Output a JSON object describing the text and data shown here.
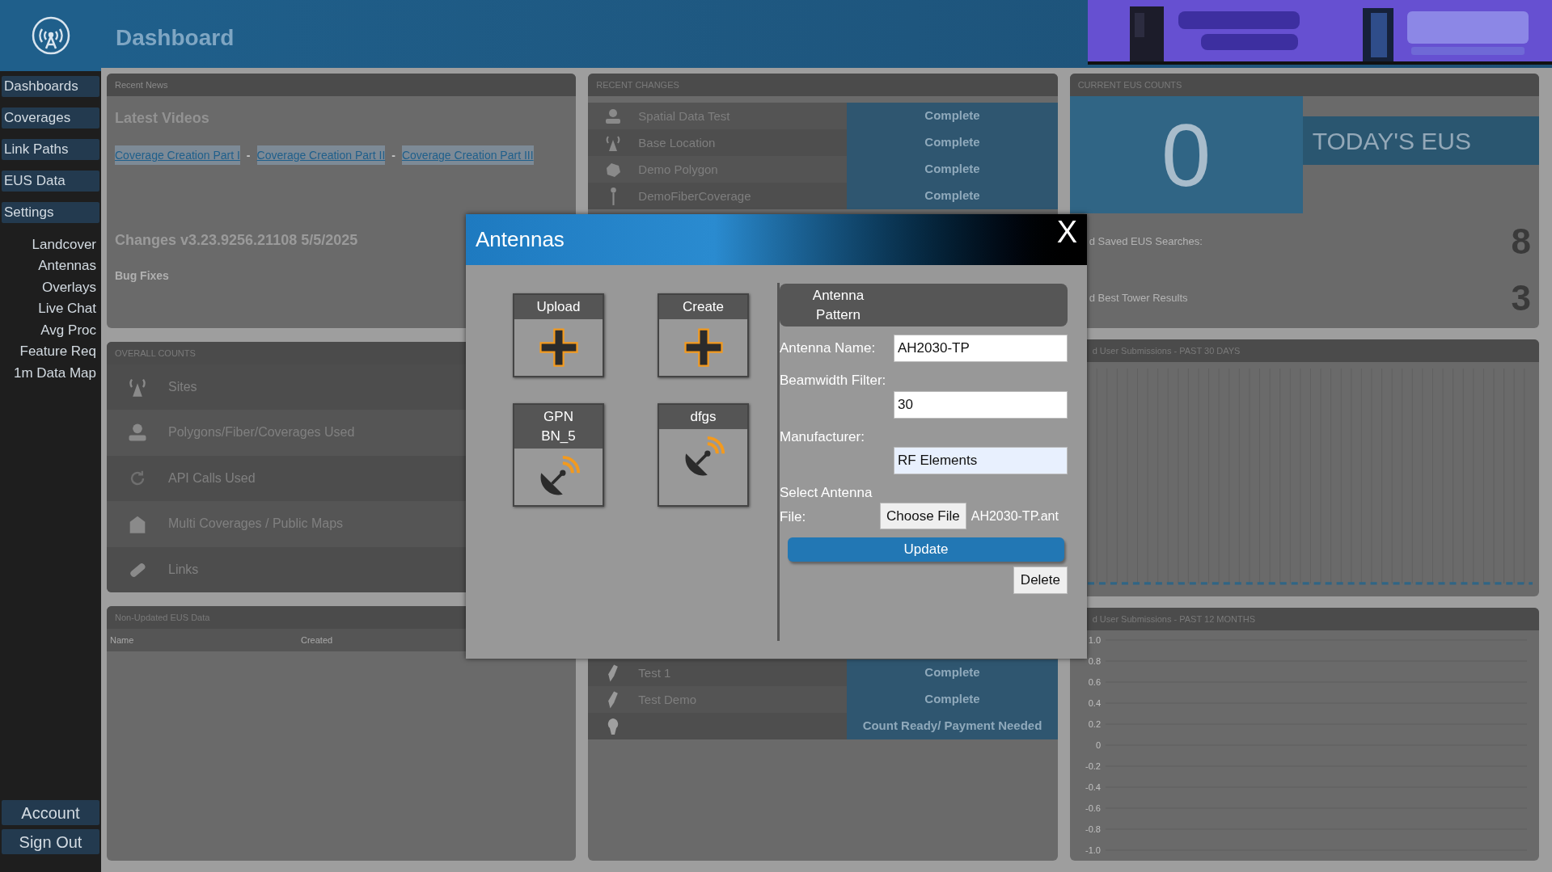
{
  "sidebar": {
    "nav": [
      {
        "label": "Dashboards",
        "kind": "main"
      },
      {
        "label": "Coverages",
        "kind": "main"
      },
      {
        "label": "Link Paths",
        "kind": "main"
      },
      {
        "label": "EUS Data",
        "kind": "main"
      },
      {
        "label": "Settings",
        "kind": "main"
      },
      {
        "label": "Landcover",
        "kind": "sub"
      },
      {
        "label": "Antennas",
        "kind": "sub"
      },
      {
        "label": "Overlays",
        "kind": "sub"
      },
      {
        "label": "Live Chat",
        "kind": "sub"
      },
      {
        "label": "Avg Proc",
        "kind": "sub"
      },
      {
        "label": "Feature Req",
        "kind": "sub"
      },
      {
        "label": "1m Data Map",
        "kind": "sub"
      }
    ],
    "bottom": [
      "Account",
      "Sign Out"
    ]
  },
  "header": {
    "title": "Dashboard"
  },
  "recent_news": {
    "title": "Recent News",
    "heading": "Latest Videos",
    "links": [
      "Coverage Creation Part I",
      "Coverage Creation Part II",
      "Coverage Creation Part III"
    ],
    "separator": "-",
    "changes": "Changes v3.23.9256.21108 5/5/2025",
    "notes": "Bug Fixes"
  },
  "overall_counts": {
    "title": "OVERALL COUNTS",
    "rows": [
      {
        "label": "Sites",
        "kind": "tower"
      },
      {
        "label": "Polygons/Fiber/Coverages Used",
        "kind": "person"
      },
      {
        "label": "API Calls Used",
        "kind": "refresh"
      },
      {
        "label": "Multi Coverages / Public Maps",
        "kind": "building"
      },
      {
        "label": "Links",
        "kind": "link"
      }
    ]
  },
  "non_updated": {
    "title": "Non-Updated EUS Data",
    "columns": [
      "Name",
      "Created"
    ]
  },
  "recent_changes": {
    "title": "RECENT CHANGES",
    "rows": [
      {
        "name": "Spatial Data Test",
        "status": "Complete",
        "kind": "person"
      },
      {
        "name": "Base Location",
        "status": "Complete",
        "kind": "tower"
      },
      {
        "name": "Demo Polygon",
        "status": "Complete",
        "kind": "polygon"
      },
      {
        "name": "DemoFiberCoverage",
        "status": "Complete",
        "kind": "fiber"
      },
      {
        "kind": "gap"
      },
      {
        "name": "Test 1",
        "status": "Complete",
        "kind": "pen"
      },
      {
        "name": "Test Demo",
        "status": "Complete",
        "kind": "pen"
      },
      {
        "status": "Count Ready/ Payment Needed",
        "kind": "bulb"
      }
    ]
  },
  "eus_counts": {
    "title": "CURRENT EUS COUNTS",
    "today_count": "0",
    "today_label": "TODAY'S EUS",
    "stats": [
      {
        "label": "d Saved EUS Searches:",
        "value": "8"
      },
      {
        "label": "d Best Tower Results",
        "value": "3"
      }
    ]
  },
  "chart_30_days": {
    "title": "d User Submissions - PAST 30 DAYS"
  },
  "chart_12_months": {
    "title": "d User Submissions - PAST 12 MONTHS",
    "y_axis_labels": [
      "1.0",
      "0.8",
      "0.6",
      "0.4",
      "0.2",
      "0",
      "-0.2",
      "-0.4",
      "-0.6",
      "-0.8",
      "-1.0"
    ]
  },
  "modal": {
    "title": "Antennas",
    "close": "X",
    "tiles": [
      {
        "label": "Upload",
        "kind": "add"
      },
      {
        "label": "Create",
        "kind": "add"
      },
      {
        "label": "GPN BN_5",
        "kind": "antenna"
      },
      {
        "label": "dfgs",
        "kind": "antenna"
      }
    ],
    "section_title": "Antenna Pattern",
    "fields": [
      {
        "label": "Antenna Name:",
        "value": "AH2030-TP",
        "autofilled": false
      },
      {
        "label": "Beamwidth Filter:",
        "value": "30",
        "autofilled": false
      },
      {
        "label": "Manufacturer:",
        "value": "RF Elements",
        "autofilled": true
      }
    ],
    "file": {
      "label": "Select Antenna File:",
      "button": "Choose File",
      "filename": "AH2030-TP.ant"
    },
    "update_button": "Update",
    "delete_button": "Delete"
  }
}
